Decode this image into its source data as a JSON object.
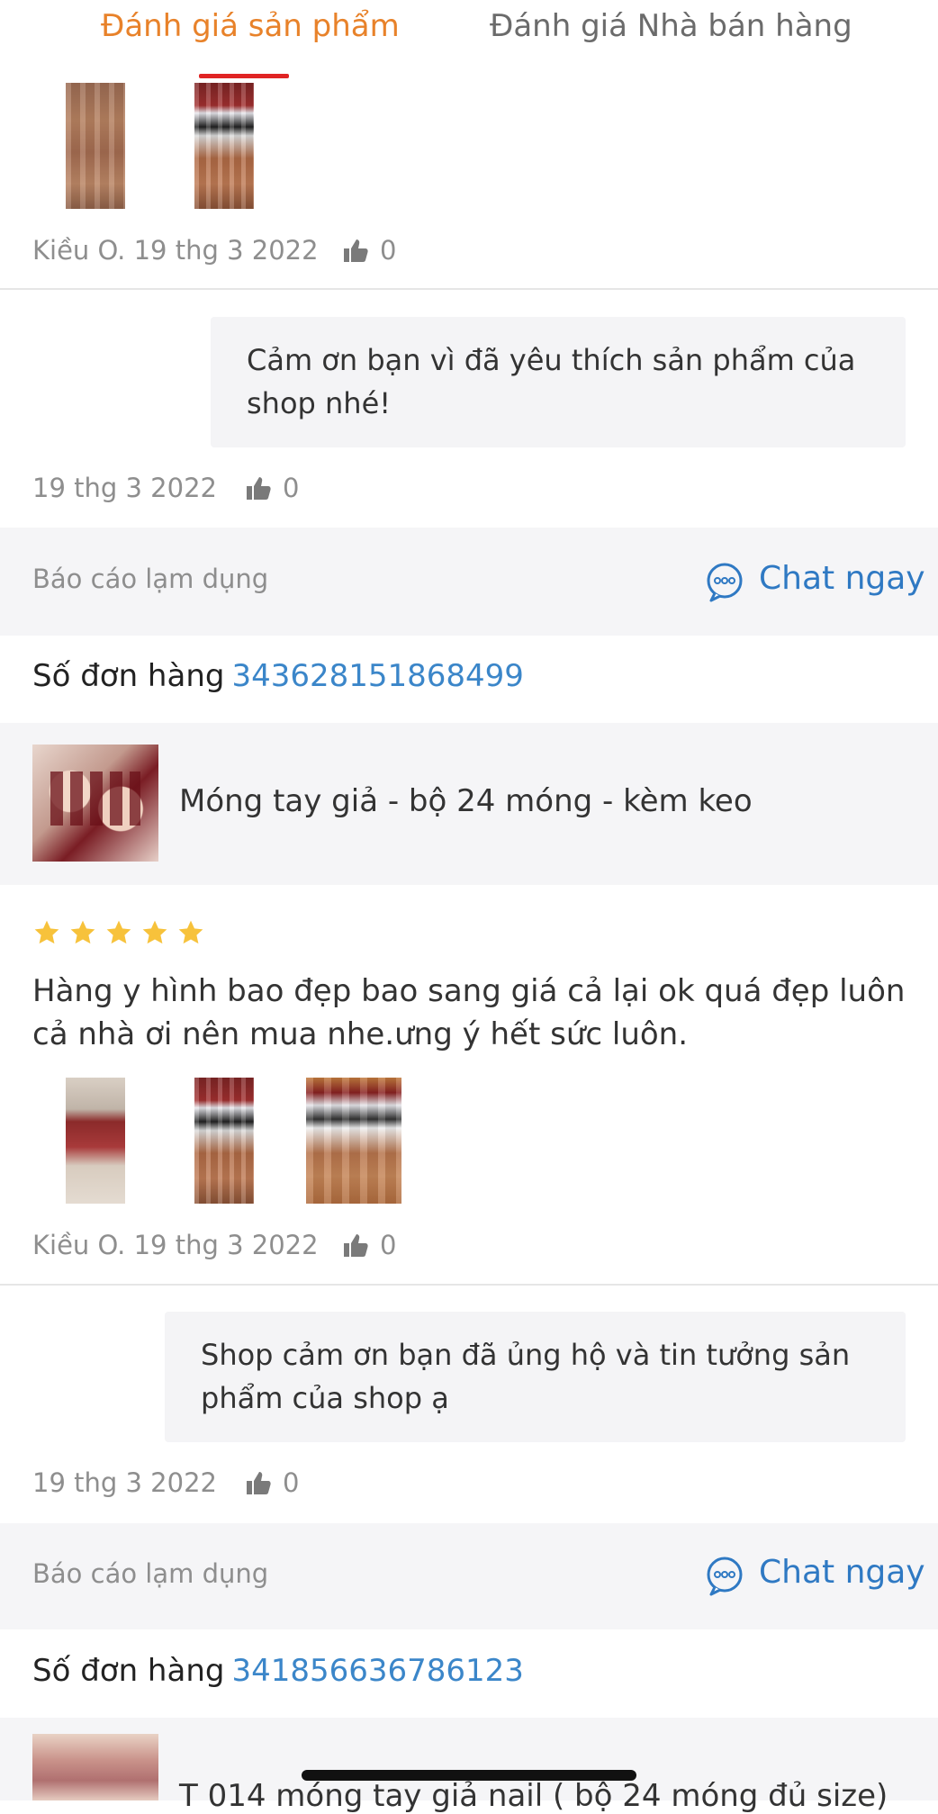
{
  "tabs": {
    "product": "Đánh giá sản phẩm",
    "seller": "Đánh giá Nhà bán hàng"
  },
  "review1": {
    "author_date": "Kiều O. 19 thg 3 2022",
    "likes": "0"
  },
  "reply1": {
    "text": "Cảm ơn bạn vì đã yêu thích sản phẩm của shop nhé!",
    "date": "19 thg 3 2022",
    "likes": "0"
  },
  "footer1": {
    "report": "Báo cáo lạm dụng",
    "chat": "Chat ngay"
  },
  "order1": {
    "label": "Số đơn hàng",
    "number": "343628151868499"
  },
  "product1": {
    "title": "Móng tay giả - bộ 24 móng - kèm keo"
  },
  "review2": {
    "rating": 5,
    "text": "Hàng y hình bao đẹp bao sang giá cả lại ok quá đẹp luôn cả nhà ơi nên mua nhe.ưng ý hết sức luôn.",
    "author_date": "Kiều O. 19 thg 3 2022",
    "likes": "0"
  },
  "reply2": {
    "text": "Shop cảm ơn bạn đã ủng hộ và tin tưởng sản phẩm của shop ạ",
    "date": "19 thg 3 2022",
    "likes": "0"
  },
  "footer2": {
    "report": "Báo cáo lạm dụng",
    "chat": "Chat ngay"
  },
  "order2": {
    "label": "Số đơn hàng",
    "number": "341856636786123"
  },
  "product2": {
    "title": "T 014 móng tay giả nail ( bộ 24 móng đủ size)"
  },
  "colors": {
    "accent": "#e8822a",
    "tab_indicator": "#e02424",
    "link": "#3b86c9",
    "chat": "#2f79c3",
    "star": "#f7c23b"
  }
}
